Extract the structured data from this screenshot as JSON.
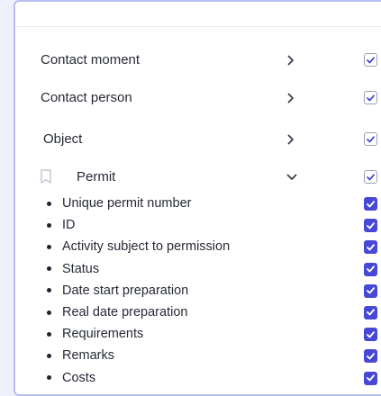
{
  "rows": [
    {
      "label": "Contact moment",
      "checked": true
    },
    {
      "label": "Contact person",
      "checked": true
    },
    {
      "label": "Object",
      "checked": true
    },
    {
      "label": "Permit",
      "checked": true,
      "expanded": true
    }
  ],
  "permit_fields": [
    {
      "label": "Unique permit number",
      "checked": true
    },
    {
      "label": "ID",
      "checked": true
    },
    {
      "label": "Activity subject to permission",
      "checked": true
    },
    {
      "label": "Status",
      "checked": true
    },
    {
      "label": "Date start preparation",
      "checked": true
    },
    {
      "label": "Real date preparation",
      "checked": true
    },
    {
      "label": "Requirements",
      "checked": true
    },
    {
      "label": "Remarks",
      "checked": true
    },
    {
      "label": "Costs",
      "checked": true
    }
  ],
  "icons": {
    "collapsed": "chevron-right-icon",
    "expanded": "chevron-down-icon",
    "bookmark": "bookmark-icon",
    "check": "check-icon"
  },
  "colors": {
    "accent": "#4848d6",
    "panel_border": "#b9bef2",
    "background": "#eef0fb",
    "outline_check_border": "#9aa0b2"
  }
}
